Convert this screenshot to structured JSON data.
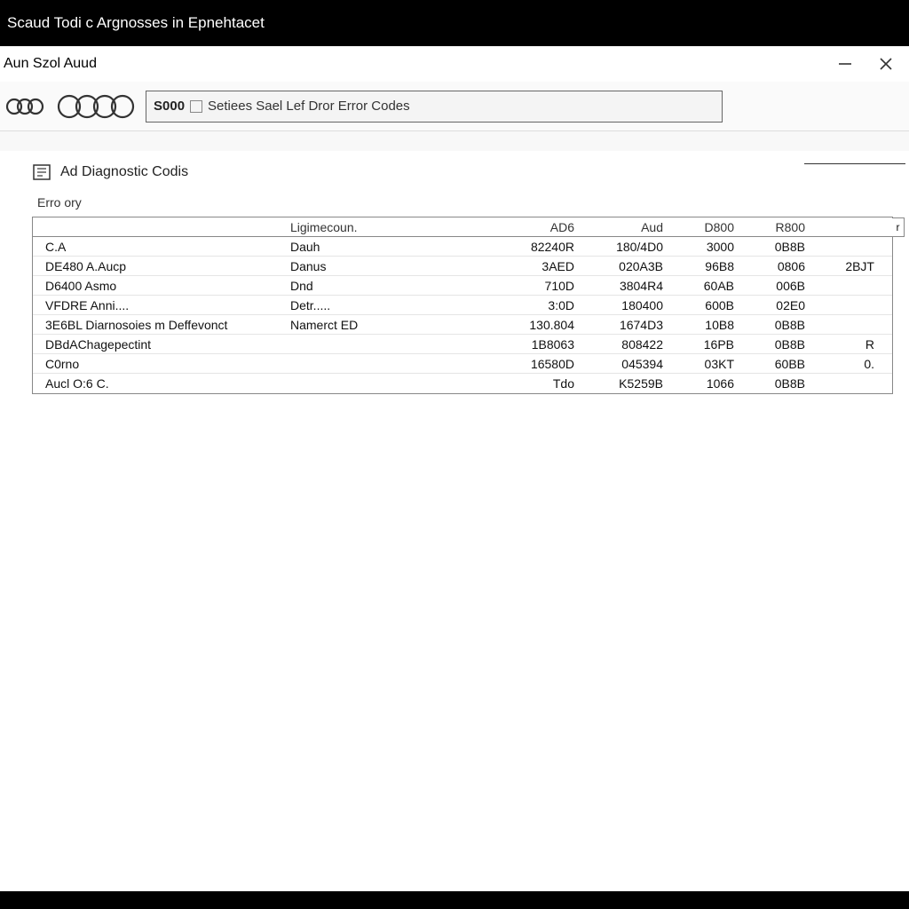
{
  "titlebar_top": "Scaud Todi c Argnosses in Epnehtacet",
  "window_title": "Aun Szol  Auud",
  "window_controls": {
    "minimize": "–",
    "close": "×"
  },
  "toolbar": {
    "search_code": "S000",
    "search_text": "Setiees Sael Lef Dror Error Codes"
  },
  "section": {
    "title": "Ad Diagnostic Codis",
    "subhead": "Erro ory"
  },
  "table": {
    "headers": [
      "",
      "Ligimecoun.",
      "AD6",
      "Aud",
      "D800",
      "R800",
      ""
    ],
    "scroll_stub": "r",
    "rows": [
      {
        "c0": "C.A",
        "c1": "Dauh",
        "c2": "82240R",
        "c3": "180/4D0",
        "c4": "3000",
        "c5": "0B8B",
        "c6": ""
      },
      {
        "c0": "DE480 A.Aucp",
        "c1": "Danus",
        "c2": "3AED",
        "c3": "020A3B",
        "c4": "96B8",
        "c5": "0806",
        "c6": "2BJT"
      },
      {
        "c0": "D6400 Asmo",
        "c1": "Dnd",
        "c2": "710D",
        "c3": "3804R4",
        "c4": "60AB",
        "c5": "006B",
        "c6": ""
      },
      {
        "c0": "VFDRE Anni....",
        "c1": "Detr.....",
        "c2": "3:0D",
        "c3": "180400",
        "c4": "600B",
        "c5": "02E0",
        "c6": ""
      },
      {
        "c0": "3E6BL Diarnosoies m Deffevonct",
        "c1": "Namerct ED",
        "c2": "130.804",
        "c3": "1674D3",
        "c4": "10B8",
        "c5": "0B8B",
        "c6": ""
      },
      {
        "c0": "DBdAChagepectint",
        "c1": "",
        "c2": "1B8063",
        "c3": "808422",
        "c4": "16PB",
        "c5": "0B8B",
        "c6": "R"
      },
      {
        "c0": "C0rno",
        "c1": "",
        "c2": "16580D",
        "c3": "045394",
        "c4": "03KT",
        "c5": "60BB",
        "c6": "0."
      },
      {
        "c0": "Aucl O:6 C.",
        "c1": "",
        "c2": "Tdo",
        "c3": "K5259B",
        "c4": "1066",
        "c5": "0B8B",
        "c6": ""
      }
    ]
  }
}
